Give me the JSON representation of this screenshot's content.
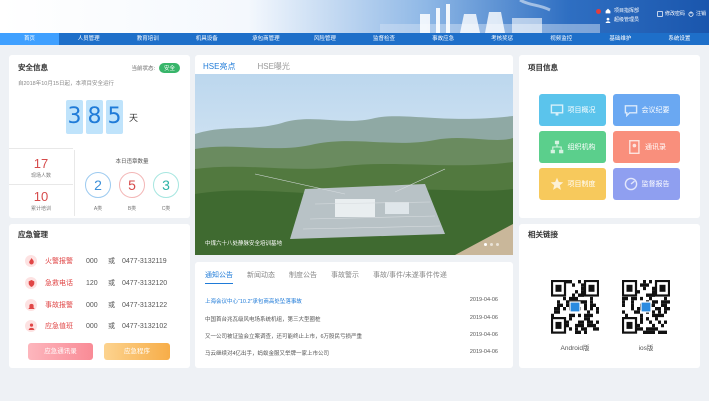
{
  "header": {
    "info_lines": [
      "项目指挥部",
      "超级管理员"
    ],
    "right_links": [
      "修改密码",
      "注销"
    ]
  },
  "nav": [
    "首页",
    "人员管理",
    "教育培训",
    "机具设备",
    "承包商管理",
    "风险管理",
    "监督检查",
    "事故应急",
    "考核奖惩",
    "视频监控",
    "基础维护",
    "系统设置"
  ],
  "safety": {
    "title": "安全信息",
    "status_label": "当前状态:",
    "status_value": "安全",
    "description": "自2018年10月15日起，本项目安全运行",
    "days_digits": [
      "3",
      "8",
      "5"
    ],
    "days_unit": "天",
    "left_stats": [
      {
        "value": "17",
        "label": "现场人数"
      },
      {
        "value": "10",
        "label": "累计培训"
      }
    ],
    "today_title": "本日违章数量",
    "today_stats": [
      {
        "value": "2",
        "label": "A类"
      },
      {
        "value": "5",
        "label": "B类"
      },
      {
        "value": "3",
        "label": "C类"
      }
    ]
  },
  "emergency": {
    "title": "应急管理",
    "rows": [
      {
        "name": "火警报警",
        "code": "000",
        "or": "或",
        "tel": "0477-3132119"
      },
      {
        "name": "急救电话",
        "code": "120",
        "or": "或",
        "tel": "0477-3132120"
      },
      {
        "name": "事故报警",
        "code": "000",
        "or": "或",
        "tel": "0477-3132122"
      },
      {
        "name": "应急值班",
        "code": "000",
        "or": "或",
        "tel": "0477-3132102"
      }
    ],
    "btn_left": "应急通讯录",
    "btn_right": "应急程序"
  },
  "hse": {
    "tabs": [
      "HSE亮点",
      "HSE曝光"
    ],
    "caption": "中煤六十八处静脉安全培训基地"
  },
  "notices": {
    "tabs": [
      "通知公告",
      "新闻动态",
      "制度公告",
      "事故警示",
      "事故/事件/未遂事件传递"
    ],
    "rows": [
      {
        "title": "上海会议中心“10.2”承包商高处坠落事故",
        "date": "2019-04-06"
      },
      {
        "title": "中国首台兆瓦级风电场系统机组，第三大型圈桩",
        "date": "2019-04-06"
      },
      {
        "title": "又一公司被证监会立案调查，还可能终止上市，6万股民亏损严重",
        "date": "2019-04-06"
      },
      {
        "title": "马云继续对4亿出手，蚂蚁金服又举牌一家上市公司",
        "date": "2019-04-06"
      }
    ]
  },
  "project": {
    "title": "项目信息",
    "tiles": [
      {
        "label": "项目概况",
        "color": "#5bc4ec"
      },
      {
        "label": "会议纪要",
        "color": "#6aa8f2"
      },
      {
        "label": "组织机构",
        "color": "#5bcf8c"
      },
      {
        "label": "通讯录",
        "color": "#f98f7c"
      },
      {
        "label": "项目制度",
        "color": "#f7c95c"
      },
      {
        "label": "监督报告",
        "color": "#8f9ff0"
      }
    ]
  },
  "links": {
    "title": "相关链接",
    "android": "Android版",
    "ios": "ios版"
  }
}
